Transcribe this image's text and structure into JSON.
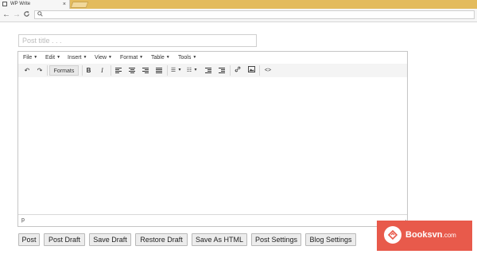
{
  "browser": {
    "tab_title": "WP Write",
    "tab_close": "×",
    "nav_back": "←",
    "nav_forward": "→",
    "nav_reload": "C",
    "search_glyph": "🔍",
    "tab_strip_color": "#e3bb5d"
  },
  "post": {
    "title_placeholder": "Post title . . .",
    "title_value": ""
  },
  "editor": {
    "menus": [
      "File",
      "Edit",
      "Insert",
      "View",
      "Format",
      "Table",
      "Tools"
    ],
    "toolbar": {
      "undo": "↶",
      "redo": "↷",
      "formats_label": "Formats",
      "bold": "B",
      "italic": "I",
      "bullet_list": "☰",
      "numbered_list": "☷",
      "dropdown_caret": "▾",
      "link": "🔗",
      "image": "▣",
      "code": "<>"
    },
    "status_path": "p"
  },
  "actions": [
    "Post",
    "Post Draft",
    "Save Draft",
    "Restore Draft",
    "Save As HTML",
    "Post Settings",
    "Blog Settings"
  ],
  "watermark": {
    "brand": "Booksvn",
    "suffix": ".com",
    "color": "#e85a4b"
  }
}
